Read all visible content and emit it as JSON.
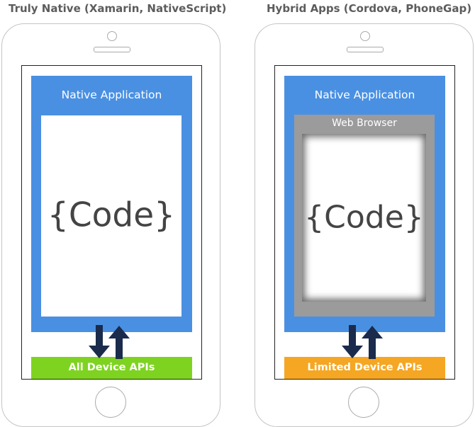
{
  "colors": {
    "app_blue": "#4a90e2",
    "all_apis_green": "#7ed321",
    "limited_apis_orange": "#f5a623",
    "browser_gray": "#9b9b9b",
    "arrow_navy": "#1a2b4c"
  },
  "columns": [
    {
      "title": "Truly Native (Xamarin, NativeScript)",
      "app_title": "Native Application",
      "code": "{Code}",
      "api_label": "All Device APIs"
    },
    {
      "title": "Hybrid Apps (Cordova, PhoneGap)",
      "app_title": "Native Application",
      "browser_title": "Web Browser",
      "code": "{Code}",
      "api_label": "Limited Device APIs"
    }
  ],
  "icons": [
    "arrow-down-icon",
    "arrow-up-icon",
    "camera-icon",
    "speaker-icon",
    "home-button-icon"
  ]
}
